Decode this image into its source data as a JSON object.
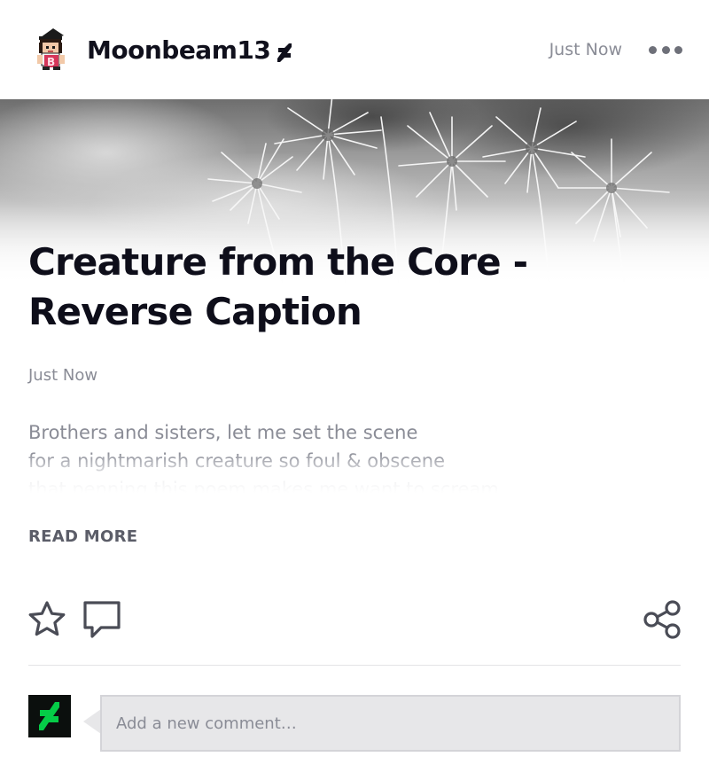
{
  "header": {
    "username": "Moonbeam13",
    "timestamp": "Just Now",
    "avatar_icon": "pixel-character-avatar-icon",
    "badge_icon": "deviantart-badge-icon",
    "more_icon": "more-dots-icon"
  },
  "post": {
    "title_line1": "Creature from the Core -",
    "title_line2": "Reverse Caption",
    "timestamp": "Just Now",
    "excerpt": [
      "Brothers and sisters, let me set the scene",
      "for a nightmarish creature so foul & obscene",
      "that penning this poem makes me want to scream."
    ],
    "read_more_label": "READ MORE"
  },
  "actions": {
    "favorite_icon": "star-icon",
    "comment_icon": "speech-bubble-icon",
    "share_icon": "share-icon"
  },
  "comment_box": {
    "placeholder": "Add a new comment…",
    "avatar_icon": "deviantart-logo-icon"
  },
  "colors": {
    "text_dark": "#0e0e1a",
    "text_muted": "#8a8c96",
    "read_more": "#5b5d68",
    "da_green": "#05cc47"
  }
}
